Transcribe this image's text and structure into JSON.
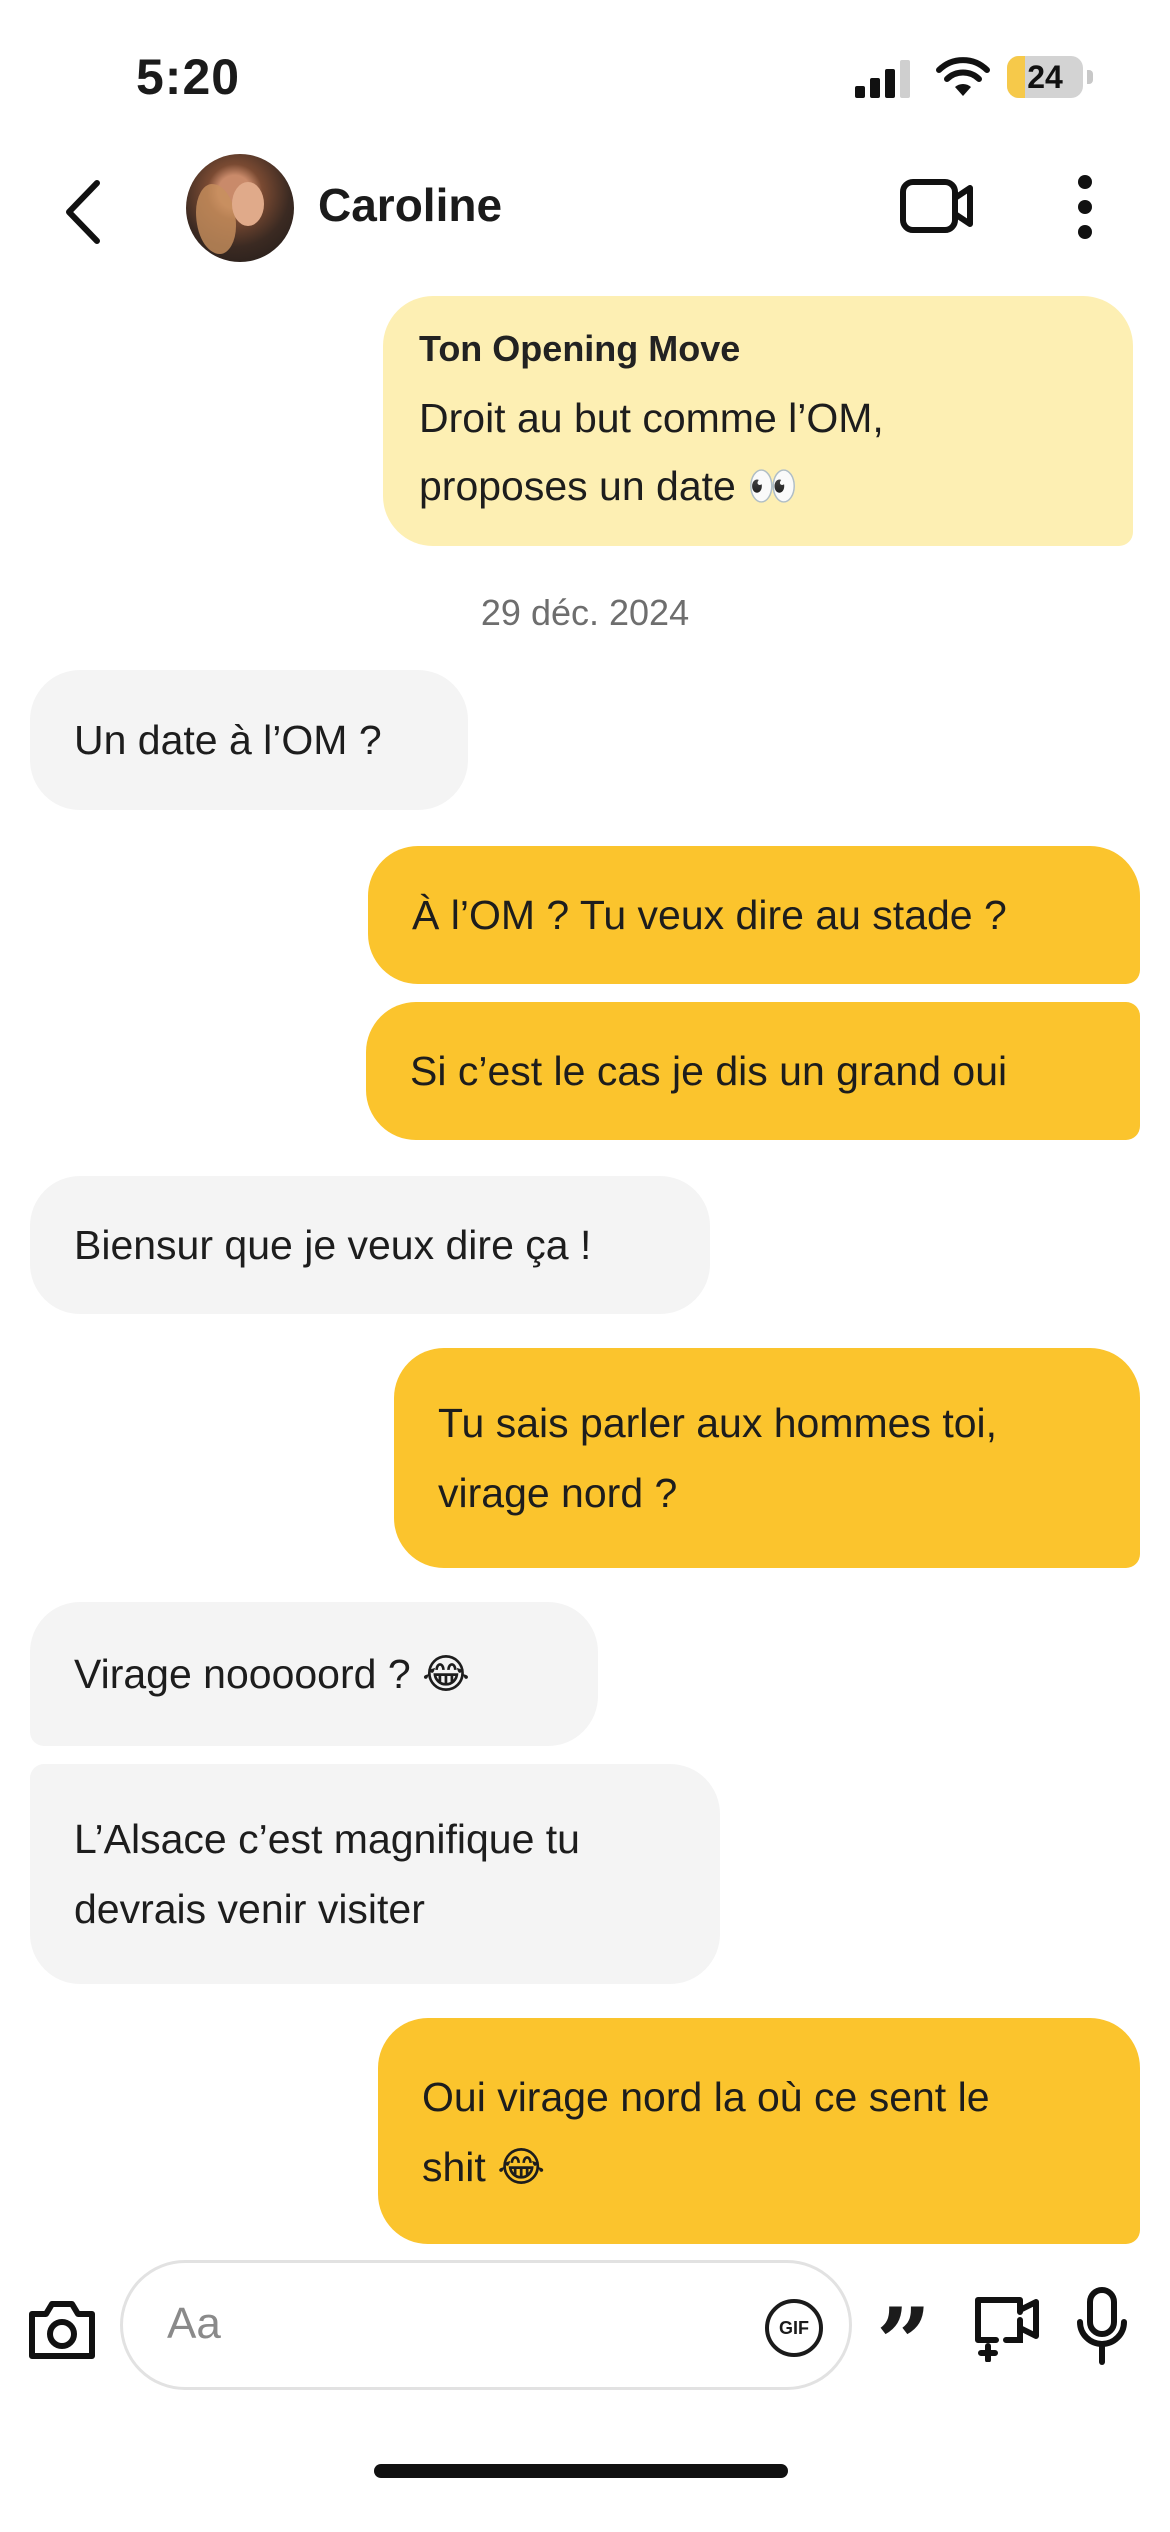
{
  "status_bar": {
    "time": "5:20",
    "battery_level": "24",
    "battery_fraction": 0.24
  },
  "header": {
    "contact_name": "Caroline"
  },
  "opening_move": {
    "title": "Ton Opening Move",
    "line1": "Droit au but comme l’OM,",
    "line2": "proposes un date 👀"
  },
  "date_separator": "29 déc. 2024",
  "messages": [
    {
      "from": "them",
      "lines": [
        "Un date à l’OM ?"
      ]
    },
    {
      "from": "me",
      "lines": [
        "À l’OM ? Tu veux dire au stade ?"
      ]
    },
    {
      "from": "me",
      "lines": [
        "Si c’est le cas je dis un grand oui"
      ]
    },
    {
      "from": "them",
      "lines": [
        "Biensur que je veux dire ça !"
      ]
    },
    {
      "from": "me",
      "lines": [
        "Tu sais parler aux hommes toi,",
        "virage nord ?"
      ]
    },
    {
      "from": "them",
      "lines": [
        "Virage nooooord ? 😂"
      ]
    },
    {
      "from": "them",
      "lines": [
        "L’Alsace c’est magnifique tu",
        "devrais venir visiter"
      ]
    },
    {
      "from": "me",
      "lines": [
        "Oui virage nord la où ce sent le",
        "shit 😂"
      ]
    }
  ],
  "composer": {
    "placeholder": "Aa",
    "gif_label": "GIF"
  },
  "colors": {
    "outgoing_bubble": "#fbc42d",
    "incoming_bubble": "#f4f4f4",
    "opening_move_bubble": "#fdefb3",
    "accent": "#f6c94a"
  }
}
